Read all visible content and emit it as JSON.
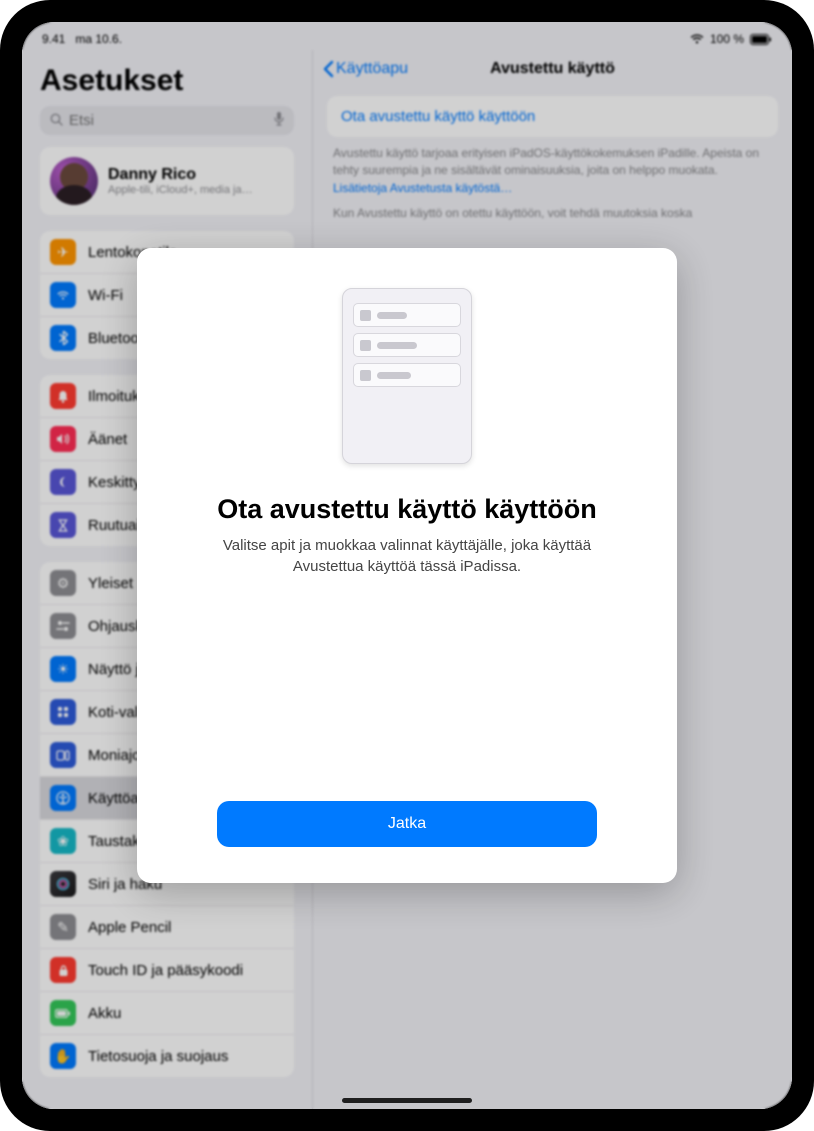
{
  "status": {
    "time": "9.41",
    "date": "ma 10.6.",
    "battery_text": "100 %"
  },
  "sidebar": {
    "title": "Asetukset",
    "search_placeholder": "Etsi",
    "account": {
      "name": "Danny Rico",
      "sub": "Apple-tili, iCloud+, media ja…"
    },
    "group1": [
      {
        "label": "Lentokonetila",
        "icon": "airplane-icon",
        "bg": "#ff9500"
      },
      {
        "label": "Wi-Fi",
        "icon": "wifi-icon",
        "bg": "#007aff"
      },
      {
        "label": "Bluetooth",
        "icon": "bluetooth-icon",
        "bg": "#007aff"
      }
    ],
    "group2": [
      {
        "label": "Ilmoitukset",
        "icon": "bell-icon",
        "bg": "#ff3b30"
      },
      {
        "label": "Äänet",
        "icon": "sound-icon",
        "bg": "#ff2d55"
      },
      {
        "label": "Keskittyminen",
        "icon": "moon-icon",
        "bg": "#5856d6"
      },
      {
        "label": "Ruutuaika",
        "icon": "hourglass-icon",
        "bg": "#5856d6"
      }
    ],
    "group3": [
      {
        "label": "Yleiset",
        "icon": "gear-icon",
        "bg": "#8e8e93"
      },
      {
        "label": "Ohjauskeskus",
        "icon": "switches-icon",
        "bg": "#8e8e93"
      },
      {
        "label": "Näyttö ja kirkkaus",
        "icon": "brightness-icon",
        "bg": "#007aff"
      },
      {
        "label": "Koti-valikko ja appikirjasto",
        "icon": "home-grid-icon",
        "bg": "#2e5bd9"
      },
      {
        "label": "Moniajo ja eleet",
        "icon": "multitask-icon",
        "bg": "#2e5bd9"
      },
      {
        "label": "Käyttöapu",
        "icon": "accessibility-icon",
        "bg": "#007aff",
        "selected": true
      },
      {
        "label": "Taustakuva",
        "icon": "wallpaper-icon",
        "bg": "#17b9c7"
      },
      {
        "label": "Siri ja haku",
        "icon": "siri-icon",
        "bg": "#2b2b2e"
      },
      {
        "label": "Apple Pencil",
        "icon": "pencil-icon",
        "bg": "#8e8e93"
      },
      {
        "label": "Touch ID ja pääsykoodi",
        "icon": "lock-icon",
        "bg": "#ff3b30"
      },
      {
        "label": "Akku",
        "icon": "battery-icon",
        "bg": "#34c759"
      },
      {
        "label": "Tietosuoja ja suojaus",
        "icon": "hand-icon",
        "bg": "#007aff"
      }
    ]
  },
  "main": {
    "back_label": "Käyttöapu",
    "title": "Avustettu käyttö",
    "enable_label": "Ota avustettu käyttö käyttöön",
    "description1": "Avustettu käyttö tarjoaa erityisen iPadOS-käyttökokemuksen iPadille. Apeista on tehty suurempia ja ne sisältävät ominaisuuksia, joita on helppo muokata.",
    "description2_prefix": "Kun Avustettu käyttö on otettu käyttöön, voit tehdä muutoksia koska ",
    "learn_more_label": "Lisätietoja Avustetusta käytöstä…"
  },
  "modal": {
    "title": "Ota avustettu käyttö käyttöön",
    "desc": "Valitse apit ja muokkaa valinnat käyttäjälle, joka käyttää Avustettua käyttöä tässä iPadissa.",
    "continue_label": "Jatka"
  }
}
